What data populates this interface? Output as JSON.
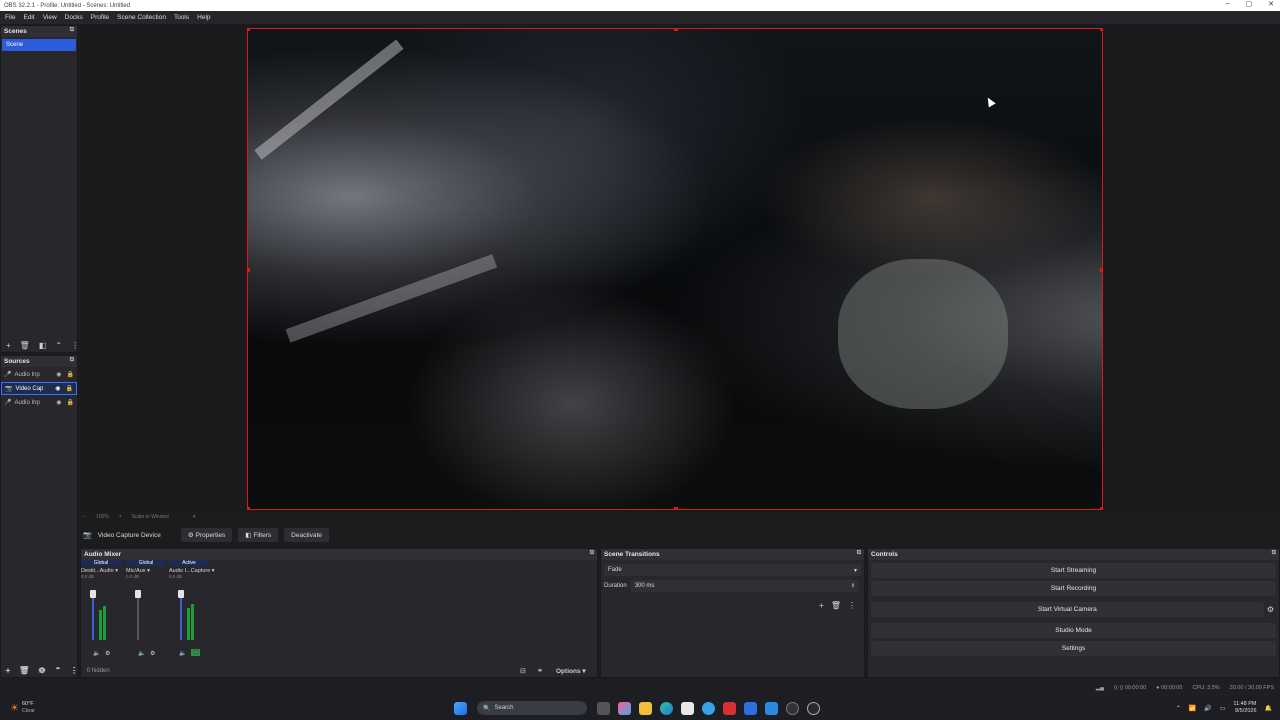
{
  "window": {
    "title": "OBS 32.2.1 - Profile: Untitled - Scenes: Untitled"
  },
  "menu": [
    "File",
    "Edit",
    "View",
    "Docks",
    "Profile",
    "Scene Collection",
    "Tools",
    "Help"
  ],
  "scenes": {
    "title": "Scenes",
    "items": [
      "Scene"
    ]
  },
  "sources": {
    "title": "Sources",
    "items": [
      {
        "label": "Audio Inp",
        "icon": "microphone-icon",
        "selected": false
      },
      {
        "label": "Video Cap",
        "icon": "camera-icon",
        "selected": true
      },
      {
        "label": "Audio Inp",
        "icon": "microphone-icon",
        "selected": false
      }
    ]
  },
  "preview": {
    "zoom_a": "100%",
    "zoom_b": "Scale to Window"
  },
  "context": {
    "source_name": "Video Capture Device",
    "properties": "Properties",
    "filters": "Filters",
    "deactivate": "Deactivate"
  },
  "audio_mixer": {
    "title": "Audio Mixer",
    "channels": [
      {
        "tag": "Global",
        "name": "Deskt...Audio",
        "db": "0.0 dB"
      },
      {
        "tag": "Global",
        "name": "Mic/Aux",
        "db": "0.0 dB"
      },
      {
        "tag": "Active",
        "name": "Audio I...Capture",
        "db": "0.0 dB"
      }
    ],
    "hidden": "0 hidden",
    "options": "Options"
  },
  "transitions": {
    "title": "Scene Transitions",
    "type": "Fade",
    "duration_label": "Duration",
    "duration_value": "300 ms"
  },
  "controls": {
    "title": "Controls",
    "buttons": [
      "Start Streaming",
      "Start Recording",
      "Start Virtual Camera",
      "Studio Mode",
      "Settings"
    ]
  },
  "status": {
    "time_a": "00:00:00",
    "time_b": "00:00:00",
    "cpu": "CPU: 3.5%",
    "fps": "30.00 / 30.00 FPS"
  },
  "taskbar": {
    "weather_temp": "60°F",
    "weather_desc": "Clear",
    "search_placeholder": "Search",
    "clock_time": "11:48 PM",
    "clock_date": "8/5/2026"
  },
  "colors": {
    "accent": "#2c5bdc",
    "preview_border": "#d81a1a",
    "meter": "#1e9c3a"
  }
}
